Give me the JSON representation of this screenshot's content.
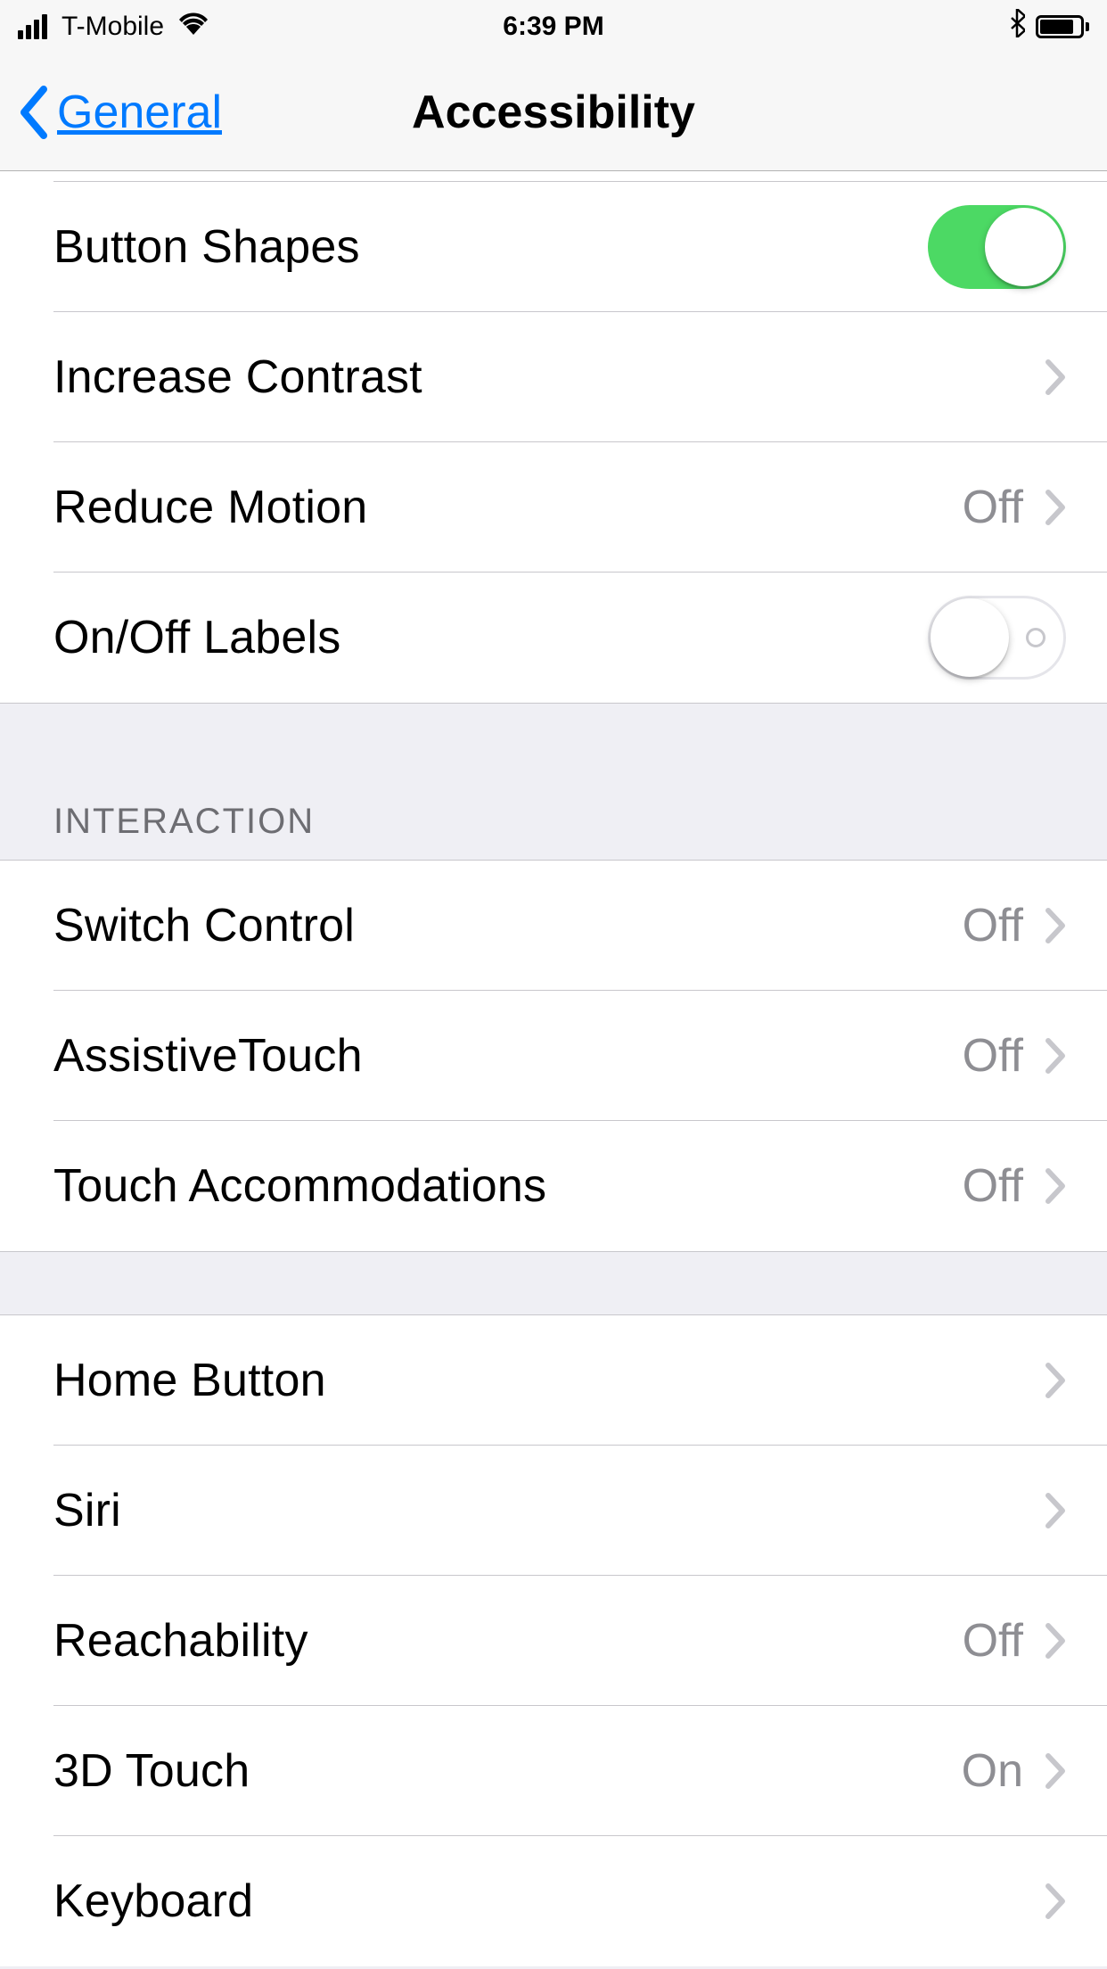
{
  "status_bar": {
    "carrier": "T-Mobile",
    "time": "6:39 PM"
  },
  "nav": {
    "back_label": "General",
    "title": "Accessibility"
  },
  "group1": {
    "button_shapes_label": "Button Shapes",
    "increase_contrast_label": "Increase Contrast",
    "reduce_motion_label": "Reduce Motion",
    "reduce_motion_value": "Off",
    "onoff_labels_label": "On/Off Labels"
  },
  "section_interaction": "INTERACTION",
  "group2": {
    "switch_control_label": "Switch Control",
    "switch_control_value": "Off",
    "assistivetouch_label": "AssistiveTouch",
    "assistivetouch_value": "Off",
    "touch_accommodations_label": "Touch Accommodations",
    "touch_accommodations_value": "Off"
  },
  "group3": {
    "home_button_label": "Home Button",
    "siri_label": "Siri",
    "reachability_label": "Reachability",
    "reachability_value": "Off",
    "threed_touch_label": "3D Touch",
    "threed_touch_value": "On",
    "keyboard_label": "Keyboard"
  }
}
